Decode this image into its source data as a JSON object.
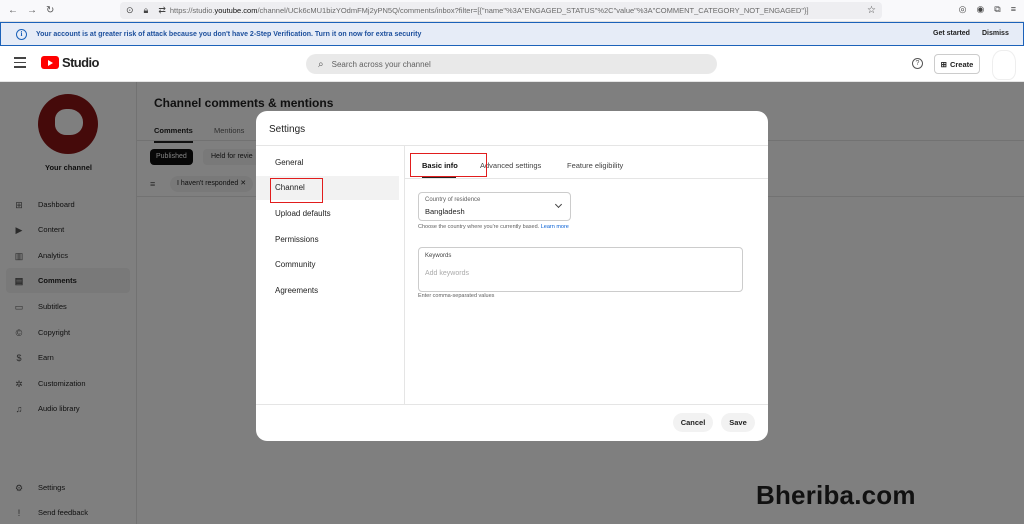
{
  "browser": {
    "url_prefix": "https://studio.",
    "url_domain": "youtube.com",
    "url_rest": "/channel/UCk6cMU1bizYOdmFMj2yPN5Q/comments/inbox?filter=[{\"name\"%3A\"ENGAGED_STATUS\"%2C\"value\"%3A\"COMMENT_CATEGORY_NOT_ENGAGED\"}]"
  },
  "banner": {
    "message": "Your account is at greater risk of attack because you don't have 2-Step Verification. Turn it on now for extra security",
    "get_started": "Get started",
    "dismiss": "Dismiss"
  },
  "header": {
    "logo_text": "Studio",
    "search_placeholder": "Search across your channel",
    "create_label": "Create"
  },
  "sidebar": {
    "channel_label": "Your channel",
    "items": [
      {
        "label": "Dashboard",
        "icon": "dashboard-icon",
        "glyph": "⊞"
      },
      {
        "label": "Content",
        "icon": "content-icon",
        "glyph": "▶"
      },
      {
        "label": "Analytics",
        "icon": "analytics-icon",
        "glyph": "▥"
      },
      {
        "label": "Comments",
        "icon": "comments-icon",
        "glyph": "▤"
      },
      {
        "label": "Subtitles",
        "icon": "subtitles-icon",
        "glyph": "▭"
      },
      {
        "label": "Copyright",
        "icon": "copyright-icon",
        "glyph": "©"
      },
      {
        "label": "Earn",
        "icon": "earn-icon",
        "glyph": "$"
      },
      {
        "label": "Customization",
        "icon": "customization-icon",
        "glyph": "✲"
      },
      {
        "label": "Audio library",
        "icon": "audio-library-icon",
        "glyph": "♫"
      },
      {
        "label": "Settings",
        "icon": "settings-icon",
        "glyph": "⚙"
      },
      {
        "label": "Send feedback",
        "icon": "feedback-icon",
        "glyph": "!"
      }
    ]
  },
  "page": {
    "title": "Channel comments & mentions",
    "tabs": [
      "Comments",
      "Mentions"
    ],
    "chips": [
      "Published",
      "Held for revie"
    ],
    "filter_chip": "I haven't responded"
  },
  "settings_dialog": {
    "title": "Settings",
    "nav": [
      "General",
      "Channel",
      "Upload defaults",
      "Permissions",
      "Community",
      "Agreements"
    ],
    "tabs": [
      "Basic info",
      "Advanced settings",
      "Feature eligibility"
    ],
    "country_label": "Country of residence",
    "country_value": "Bangladesh",
    "country_help": "Choose the country where you're currently based.",
    "learn_more": "Learn more",
    "keywords_label": "Keywords",
    "keywords_placeholder": "Add keywords",
    "keywords_help": "Enter comma-separated values",
    "cancel": "Cancel",
    "save": "Save"
  },
  "watermark": "Bheriba.com",
  "colors": {
    "highlight": "#e11d1d",
    "link": "#065fd4",
    "banner_text": "#1c4f9c",
    "yt_red": "#ff0000",
    "avatar_red": "#8b1414"
  }
}
